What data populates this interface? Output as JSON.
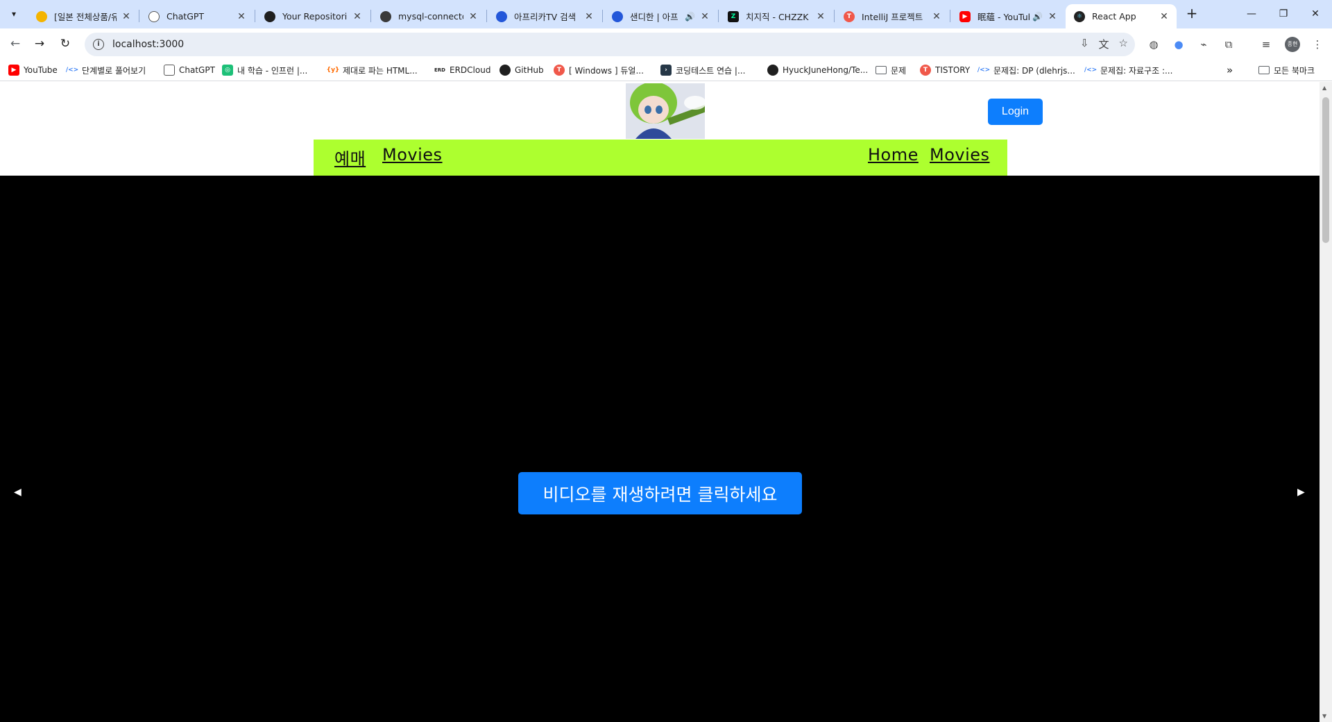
{
  "browser": {
    "tabs": [
      {
        "title": "[일본 전체상품/유",
        "icon": "bulb-icon",
        "color": "#f4b400",
        "audio": false,
        "active": false
      },
      {
        "title": "ChatGPT",
        "icon": "chatgpt-icon",
        "color": "#555555",
        "audio": false,
        "active": false
      },
      {
        "title": "Your Repositories",
        "icon": "github-icon",
        "color": "#1f1f1f",
        "audio": false,
        "active": false
      },
      {
        "title": "mysql-connector",
        "icon": "avatar-icon",
        "color": "#3a3a3a",
        "audio": false,
        "active": false
      },
      {
        "title": "아프리카TV 검색",
        "icon": "afreeca-icon",
        "color": "#2357d9",
        "audio": false,
        "active": false
      },
      {
        "title": "샌디한 | 아프",
        "icon": "afreeca-icon",
        "color": "#2357d9",
        "audio": true,
        "active": false
      },
      {
        "title": "치지직 - CHZZK",
        "icon": "chzzk-icon",
        "color": "#111111",
        "audio": false,
        "active": false
      },
      {
        "title": "IntelliJ 프로젝트",
        "icon": "tistory-icon",
        "color": "#f0584a",
        "audio": false,
        "active": false
      },
      {
        "title": "眠蘊 - YouTub",
        "icon": "youtube-icon",
        "color": "#ff0000",
        "audio": true,
        "active": false
      },
      {
        "title": "React App",
        "icon": "react-icon",
        "color": "#61dafb",
        "audio": false,
        "active": true
      }
    ],
    "url": "localhost:3000",
    "bookmarks": [
      {
        "label": "YouTube",
        "icon": "youtube-icon",
        "color": "#ff0000"
      },
      {
        "label": "단계별로 풀어보기",
        "icon": "code-icon",
        "color": "#3b82f6"
      },
      {
        "label": "ChatGPT",
        "icon": "chatgpt-icon",
        "color": "#555555"
      },
      {
        "label": "내 학습 - 인프런 |...",
        "icon": "inflearn-icon",
        "color": "#1dc078"
      },
      {
        "label": "제대로 파는 HTML...",
        "icon": "yes-icon",
        "color": "#ff6a00"
      },
      {
        "label": "ERDCloud",
        "icon": "erd-icon",
        "color": "#222222"
      },
      {
        "label": "GitHub",
        "icon": "github-icon",
        "color": "#1f1f1f"
      },
      {
        "label": "[ Windows ] 듀얼...",
        "icon": "tistory-icon",
        "color": "#f0584a"
      },
      {
        "label": "코딩테스트 연습 |...",
        "icon": "programmers-icon",
        "color": "#263747"
      },
      {
        "label": "HyuckJuneHong/Te...",
        "icon": "github-icon",
        "color": "#1f1f1f"
      },
      {
        "label": "문제",
        "icon": "folder-icon",
        "color": "#5f6368"
      },
      {
        "label": "TISTORY",
        "icon": "tistory-icon",
        "color": "#f0584a"
      },
      {
        "label": "문제집: DP (dlehrjs...",
        "icon": "code-icon",
        "color": "#3b82f6"
      },
      {
        "label": "문제집: 자료구조 :...",
        "icon": "code-icon",
        "color": "#3b82f6"
      }
    ],
    "all_bookmarks": "모든 북마크"
  },
  "page": {
    "login_label": "Login",
    "nav_left": [
      "예매",
      "Movies"
    ],
    "nav_right": [
      "Home",
      "Movies"
    ],
    "play_label": "비디오를 재생하려면 클릭하세요",
    "accent": "#0d7efd",
    "nav_bg": "#adff2f"
  }
}
